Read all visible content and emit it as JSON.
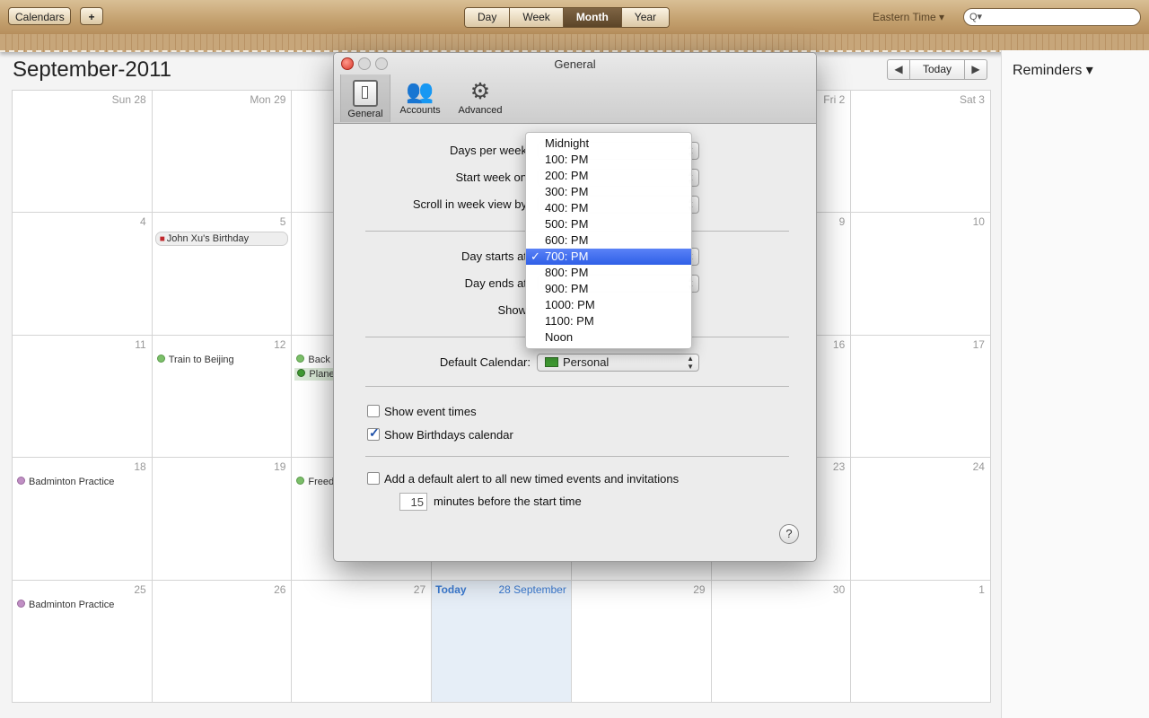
{
  "toolbar": {
    "calendars_label": "Calendars",
    "add_label": "+",
    "views": [
      "Day",
      "Week",
      "Month",
      "Year"
    ],
    "active_view": "Month",
    "timezone": "Eastern Time ▾",
    "search_icon": "Q▾"
  },
  "calendar": {
    "title": "September-2011",
    "today_label": "Today",
    "prev_symbol": "◀",
    "next_symbol": "▶",
    "weeks": [
      [
        {
          "d": "Sun 28"
        },
        {
          "d": "Mon 29"
        },
        {
          "d": ""
        },
        {
          "d": ""
        },
        {
          "d": ""
        },
        {
          "d": "Fri 2"
        },
        {
          "d": "Sat 3"
        }
      ],
      [
        {
          "d": "4"
        },
        {
          "d": "5"
        },
        {
          "d": ""
        },
        {
          "d": ""
        },
        {
          "d": ""
        },
        {
          "d": "9"
        },
        {
          "d": "10"
        }
      ],
      [
        {
          "d": "11"
        },
        {
          "d": "12"
        },
        {
          "d": ""
        },
        {
          "d": ""
        },
        {
          "d": ""
        },
        {
          "d": "16"
        },
        {
          "d": "17"
        }
      ],
      [
        {
          "d": "18"
        },
        {
          "d": "19"
        },
        {
          "d": ""
        },
        {
          "d": ""
        },
        {
          "d": ""
        },
        {
          "d": "23"
        },
        {
          "d": "24"
        }
      ],
      [
        {
          "d": "25"
        },
        {
          "d": "26"
        },
        {
          "d": "27"
        },
        {
          "d": "28 September",
          "today": "Today"
        },
        {
          "d": "29"
        },
        {
          "d": "30"
        },
        {
          "d": "1"
        }
      ]
    ],
    "events": {
      "john_birthday": "John Xu's Birthday",
      "train": "Train to Beijing",
      "back": "Back",
      "plane": "Plane",
      "badminton_1": "Badminton Practice",
      "freed": "Freed",
      "badminton_2": "Badminton Practice"
    },
    "colors": {
      "green": "#7cc06a",
      "purple": "#c08fc4",
      "today_blue": "#3a7ad1"
    }
  },
  "reminders": {
    "title": "Reminders ▾"
  },
  "dialog": {
    "title": "General",
    "tabs": [
      "General",
      "Accounts",
      "Advanced"
    ],
    "labels": {
      "days_per_week": "Days per week",
      "start_week_on": "Start week on",
      "scroll_week": "Scroll in week view by",
      "day_starts": "Day starts at",
      "day_ends": "Day ends at",
      "show": "Show",
      "default_calendar": "Default Calendar:"
    },
    "default_calendar_value": "Personal",
    "show_event_times": "Show event times",
    "show_birthdays": "Show Birthdays calendar",
    "default_alert": "Add a default alert to all new timed events and invitations",
    "minutes_value": "15",
    "minutes_label": "minutes before the start time",
    "help_symbol": "?"
  },
  "menu": {
    "items": [
      "Midnight",
      "100: PM",
      "200: PM",
      "300: PM",
      "400: PM",
      "500: PM",
      "600: PM",
      "700: PM",
      "800: PM",
      "900: PM",
      "1000: PM",
      "1100: PM",
      "Noon"
    ],
    "selected": "700: PM"
  }
}
